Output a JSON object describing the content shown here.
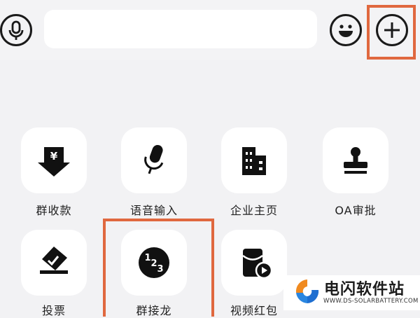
{
  "input_bar": {
    "text_value": "",
    "voice_icon": "microphone-icon",
    "emoji_icon": "smiley-face-icon",
    "more_icon": "plus-icon"
  },
  "tiles": [
    {
      "label": "群收款",
      "icon": "yuan-down-arrow-icon"
    },
    {
      "label": "语音输入",
      "icon": "microphone-icon"
    },
    {
      "label": "企业主页",
      "icon": "building-icon"
    },
    {
      "label": "OA审批",
      "icon": "stamp-icon"
    },
    {
      "label": "投票",
      "icon": "ballot-box-icon"
    },
    {
      "label": "群接龙",
      "icon": "number-123-icon"
    },
    {
      "label": "视频红包",
      "icon": "video-red-packet-icon"
    }
  ],
  "highlight_color": "#e0683f",
  "watermark": {
    "title": "电闪软件站",
    "url": "WWW.DS-SOLARBATTERY.COM"
  }
}
